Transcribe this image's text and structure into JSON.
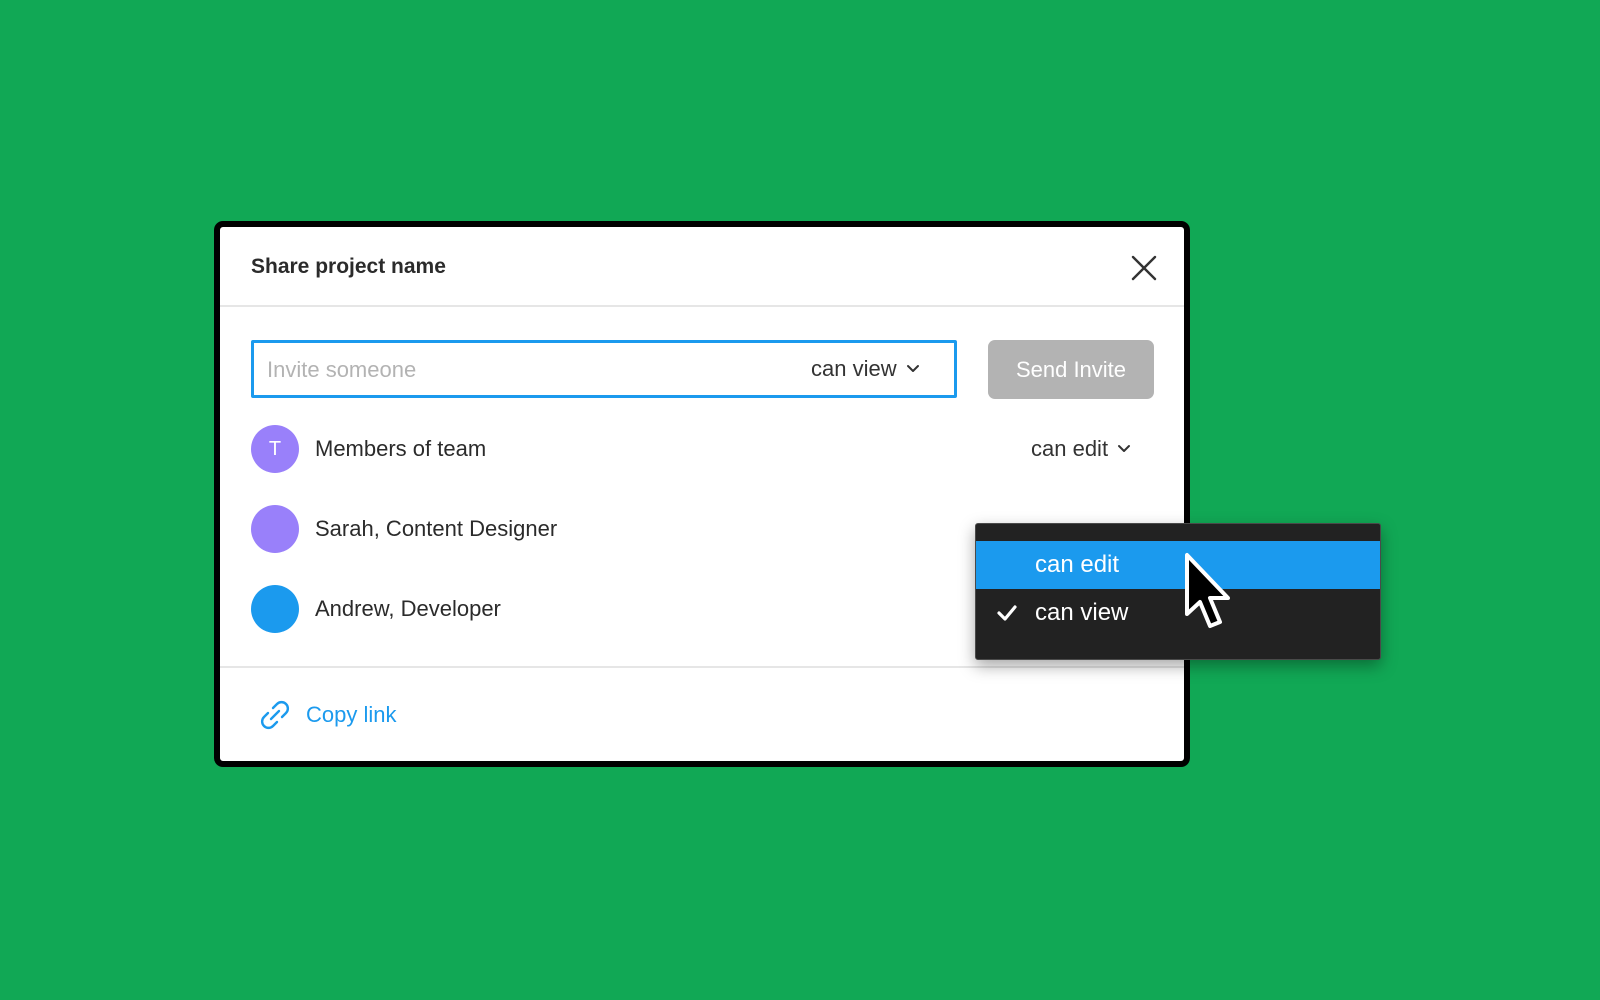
{
  "dialog": {
    "title": "Share project name",
    "close_icon": "close-icon"
  },
  "invite": {
    "placeholder": "Invite someone",
    "value": "",
    "permission": "can view",
    "send_label": "Send Invite"
  },
  "members": [
    {
      "initial": "T",
      "name": "Members of team",
      "permission": "can edit",
      "avatar_color": "#9980fa"
    },
    {
      "initial": "",
      "name": "Sarah, Content Designer",
      "avatar_color": "#9980fa"
    },
    {
      "initial": "",
      "name": "Andrew, Developer",
      "avatar_color": "#1b9aee"
    }
  ],
  "footer": {
    "copy_link_label": "Copy link",
    "link_icon": "link-icon"
  },
  "permission_menu": {
    "items": [
      {
        "label": "can edit",
        "highlighted": true,
        "checked": false
      },
      {
        "label": "can view",
        "highlighted": false,
        "checked": true
      }
    ]
  },
  "colors": {
    "background": "#11a855",
    "accent": "#1b9aee",
    "avatar_purple": "#9980fa",
    "disabled_button": "#b3b3b3",
    "menu_background": "#222222"
  }
}
